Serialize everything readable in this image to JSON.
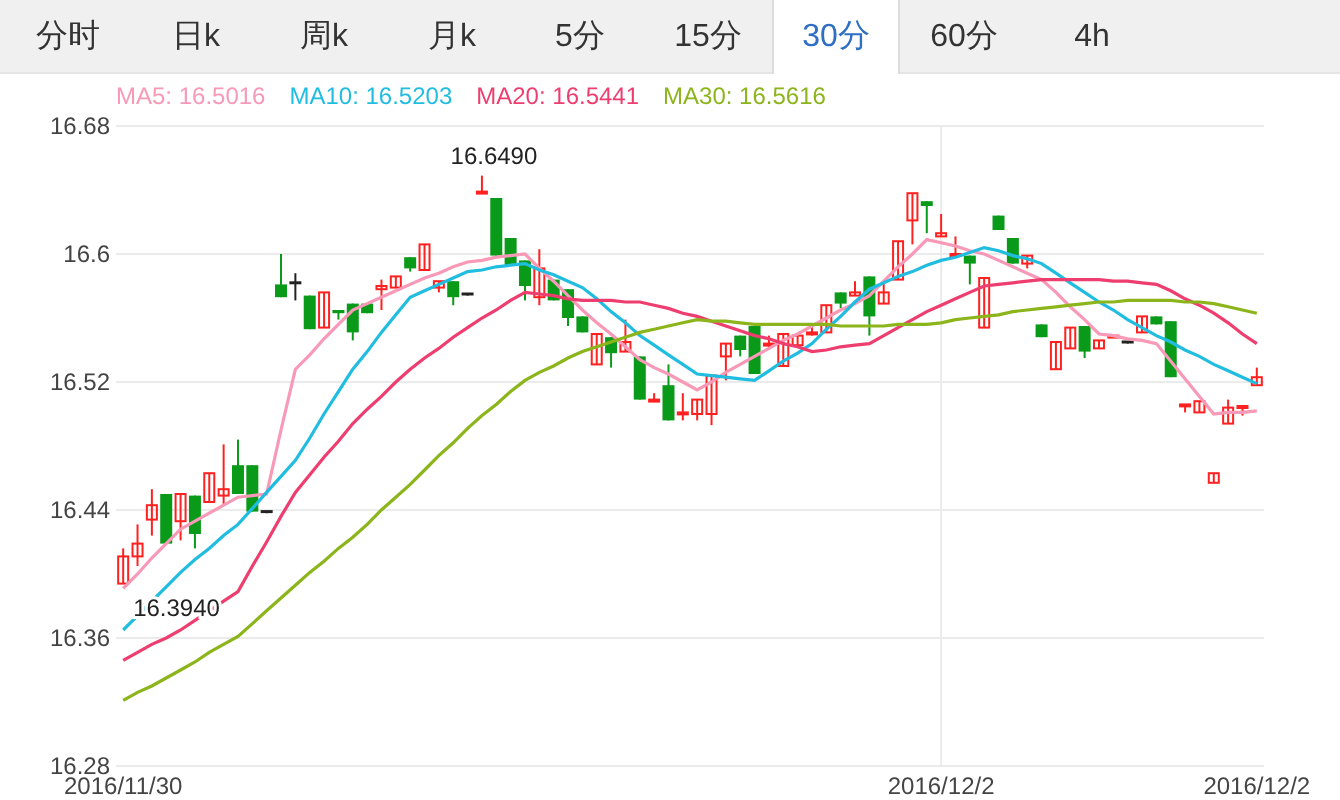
{
  "tabs": [
    {
      "label": "分时",
      "selected": false
    },
    {
      "label": "日k",
      "selected": false
    },
    {
      "label": "周k",
      "selected": false
    },
    {
      "label": "月k",
      "selected": false
    },
    {
      "label": "5分",
      "selected": false
    },
    {
      "label": "15分",
      "selected": false
    },
    {
      "label": "30分",
      "selected": true
    },
    {
      "label": "60分",
      "selected": false
    },
    {
      "label": "4h",
      "selected": false
    }
  ],
  "legend": [
    {
      "value": ": 16.5016"
    },
    {
      "value": ": 16.5203"
    },
    {
      "value": ": 16.5441"
    },
    {
      "value": ": 16.5616"
    }
  ],
  "chart": {
    "chart_data": {
      "type": "candlestick",
      "categories": [
        "2016/11/30",
        null,
        null,
        null,
        null,
        null,
        null,
        null,
        null,
        null,
        null,
        null,
        null,
        null,
        null,
        null,
        null,
        null,
        null,
        null,
        null,
        null,
        null,
        null,
        null,
        null,
        null,
        null,
        null,
        null,
        null,
        null,
        null,
        null,
        null,
        null,
        null,
        null,
        null,
        null,
        null,
        null,
        null,
        null,
        null,
        null,
        null,
        null,
        null,
        null,
        null,
        null,
        null,
        null,
        null,
        null,
        null,
        "2016/12/2",
        null,
        null,
        null,
        null,
        null,
        null,
        null,
        null,
        null,
        null,
        null,
        null,
        null,
        null,
        null,
        null,
        null,
        null,
        null,
        null,
        null,
        "2016/12/2"
      ],
      "ohlc": [
        [
          16.394,
          16.416,
          16.394,
          16.411
        ],
        [
          16.411,
          16.431,
          16.405,
          16.419
        ],
        [
          16.434,
          16.453,
          16.424,
          16.443
        ],
        [
          16.45,
          16.45,
          16.419,
          16.419
        ],
        [
          16.433,
          16.45,
          16.421,
          16.45
        ],
        [
          16.449,
          16.449,
          16.416,
          16.425
        ],
        [
          16.445,
          16.463,
          16.445,
          16.463
        ],
        [
          16.449,
          16.481,
          16.443,
          16.453
        ],
        [
          16.468,
          16.484,
          16.45,
          16.45
        ],
        [
          16.468,
          16.468,
          16.439,
          16.439
        ],
        [
          16.439,
          16.439,
          16.438,
          16.439
        ],
        [
          16.581,
          16.6,
          16.573,
          16.573
        ],
        [
          16.582,
          16.588,
          16.571,
          16.582
        ],
        [
          16.574,
          16.574,
          16.553,
          16.553
        ],
        [
          16.554,
          16.576,
          16.554,
          16.576
        ],
        [
          16.565,
          16.565,
          16.559,
          16.563
        ],
        [
          16.569,
          16.569,
          16.546,
          16.551
        ],
        [
          16.569,
          16.569,
          16.563,
          16.563
        ],
        [
          16.578,
          16.584,
          16.565,
          16.58
        ],
        [
          16.579,
          16.586,
          16.579,
          16.586
        ],
        [
          16.598,
          16.598,
          16.589,
          16.591
        ],
        [
          16.59,
          16.606,
          16.59,
          16.606
        ],
        [
          16.579,
          16.583,
          16.576,
          16.583
        ],
        [
          16.583,
          16.583,
          16.568,
          16.573
        ],
        [
          16.575,
          16.575,
          16.574,
          16.575
        ],
        [
          16.638,
          16.649,
          16.638,
          16.639
        ],
        [
          16.635,
          16.635,
          16.598,
          16.599
        ],
        [
          16.61,
          16.61,
          16.593,
          16.593
        ],
        [
          16.596,
          16.596,
          16.571,
          16.58
        ],
        [
          16.573,
          16.603,
          16.568,
          16.591
        ],
        [
          16.584,
          16.584,
          16.571,
          16.571
        ],
        [
          16.578,
          16.578,
          16.555,
          16.56
        ],
        [
          16.561,
          16.561,
          16.551,
          16.551
        ],
        [
          16.531,
          16.55,
          16.531,
          16.55
        ],
        [
          16.548,
          16.548,
          16.529,
          16.538
        ],
        [
          16.539,
          16.559,
          16.539,
          16.545
        ],
        [
          16.536,
          16.536,
          16.509,
          16.509
        ],
        [
          16.508,
          16.513,
          16.508,
          16.509
        ],
        [
          16.518,
          16.531,
          16.496,
          16.496
        ],
        [
          16.5,
          16.513,
          16.496,
          16.501
        ],
        [
          16.5,
          16.509,
          16.496,
          16.509
        ],
        [
          16.5,
          16.524,
          16.493,
          16.524
        ],
        [
          16.536,
          16.544,
          16.521,
          16.544
        ],
        [
          16.549,
          16.549,
          16.536,
          16.54
        ],
        [
          16.555,
          16.555,
          16.525,
          16.525
        ],
        [
          16.543,
          16.549,
          16.54,
          16.544
        ],
        [
          16.53,
          16.55,
          16.53,
          16.55
        ],
        [
          16.543,
          16.549,
          16.543,
          16.549
        ],
        [
          16.55,
          16.555,
          16.549,
          16.551
        ],
        [
          16.551,
          16.568,
          16.551,
          16.568
        ],
        [
          16.576,
          16.576,
          16.566,
          16.569
        ],
        [
          16.574,
          16.583,
          16.574,
          16.576
        ],
        [
          16.586,
          16.586,
          16.549,
          16.561
        ],
        [
          16.569,
          16.583,
          16.569,
          16.576
        ],
        [
          16.584,
          16.608,
          16.584,
          16.608
        ],
        [
          16.621,
          16.638,
          16.606,
          16.638
        ],
        [
          16.633,
          16.633,
          16.613,
          16.63
        ],
        [
          16.611,
          16.625,
          16.611,
          16.613
        ],
        [
          16.599,
          16.611,
          16.599,
          16.6
        ],
        [
          16.599,
          16.599,
          16.581,
          16.594
        ],
        [
          16.554,
          16.585,
          16.554,
          16.585
        ],
        [
          16.624,
          16.624,
          16.615,
          16.615
        ],
        [
          16.61,
          16.61,
          16.594,
          16.594
        ],
        [
          16.594,
          16.599,
          16.591,
          16.599
        ],
        [
          16.556,
          16.556,
          16.548,
          16.548
        ],
        [
          16.528,
          16.545,
          16.528,
          16.545
        ],
        [
          16.541,
          16.554,
          16.541,
          16.554
        ],
        [
          16.555,
          16.555,
          16.535,
          16.539
        ],
        [
          16.541,
          16.546,
          16.541,
          16.546
        ],
        [
          16.548,
          16.549,
          16.548,
          16.549
        ],
        [
          16.545,
          16.545,
          16.544,
          16.545
        ],
        [
          16.551,
          16.561,
          16.551,
          16.561
        ],
        [
          16.561,
          16.561,
          16.556,
          16.556
        ],
        [
          16.558,
          16.558,
          16.523,
          16.523
        ],
        [
          16.505,
          16.506,
          16.501,
          16.506
        ],
        [
          16.501,
          16.508,
          16.501,
          16.508
        ],
        [
          16.457,
          16.463,
          16.457,
          16.463
        ],
        [
          16.494,
          16.509,
          16.494,
          16.504
        ],
        [
          16.504,
          16.505,
          16.499,
          16.505
        ],
        [
          16.518,
          16.529,
          16.518,
          16.523
        ]
      ],
      "series": [
        {
          "name": "MA5",
          "type": "line",
          "color": "#f799b7",
          "values": [
            16.391,
            16.4,
            16.41,
            16.419,
            16.428,
            16.433,
            16.438,
            16.443,
            16.448,
            16.449,
            16.45,
            16.49,
            16.528,
            16.537,
            16.547,
            16.556,
            16.565,
            16.569,
            16.573,
            16.577,
            16.581,
            16.585,
            16.588,
            16.592,
            16.595,
            16.596,
            16.598,
            16.599,
            16.6,
            16.591,
            16.583,
            16.574,
            16.565,
            16.557,
            16.55,
            16.542,
            16.534,
            16.529,
            16.525,
            16.52,
            16.515,
            16.52,
            16.526,
            16.531,
            16.536,
            16.541,
            16.546,
            16.55,
            16.555,
            16.56,
            16.565,
            16.569,
            16.574,
            16.583,
            16.592,
            16.6,
            16.609,
            16.607,
            16.605,
            16.602,
            16.6,
            16.596,
            16.592,
            16.588,
            16.584,
            16.576,
            16.567,
            16.559,
            16.55,
            16.549,
            16.547,
            16.546,
            16.544,
            16.533,
            16.522,
            16.511,
            16.5,
            16.501,
            16.501,
            16.502
          ]
        },
        {
          "name": "MA10",
          "type": "line",
          "color": "#21bde0",
          "values": [
            16.365,
            16.374,
            16.383,
            16.392,
            16.401,
            16.409,
            16.416,
            16.424,
            16.431,
            16.441,
            16.451,
            16.461,
            16.471,
            16.485,
            16.5,
            16.514,
            16.528,
            16.539,
            16.551,
            16.562,
            16.573,
            16.577,
            16.581,
            16.585,
            16.589,
            16.59,
            16.592,
            16.593,
            16.594,
            16.59,
            16.587,
            16.583,
            16.579,
            16.572,
            16.564,
            16.557,
            16.549,
            16.543,
            16.537,
            16.531,
            16.525,
            16.524,
            16.523,
            16.522,
            16.521,
            16.527,
            16.533,
            16.538,
            16.544,
            16.553,
            16.561,
            16.57,
            16.578,
            16.582,
            16.586,
            16.589,
            16.593,
            16.596,
            16.598,
            16.601,
            16.604,
            16.602,
            16.599,
            16.597,
            16.594,
            16.588,
            16.582,
            16.576,
            16.57,
            16.565,
            16.559,
            16.554,
            16.549,
            16.545,
            16.54,
            16.536,
            16.531,
            16.527,
            16.523,
            16.519
          ]
        },
        {
          "name": "MA20",
          "type": "line",
          "color": "#ee3d6f",
          "values": [
            16.346,
            16.351,
            16.356,
            16.36,
            16.365,
            16.371,
            16.377,
            16.383,
            16.389,
            16.405,
            16.42,
            16.436,
            16.451,
            16.462,
            16.473,
            16.483,
            16.494,
            16.503,
            16.511,
            16.52,
            16.528,
            16.535,
            16.541,
            16.548,
            16.554,
            16.56,
            16.565,
            16.571,
            16.576,
            16.575,
            16.574,
            16.572,
            16.571,
            16.571,
            16.571,
            16.57,
            16.57,
            16.568,
            16.566,
            16.563,
            16.561,
            16.558,
            16.555,
            16.552,
            16.549,
            16.547,
            16.544,
            16.542,
            16.539,
            16.54,
            16.542,
            16.543,
            16.544,
            16.549,
            16.554,
            16.559,
            16.564,
            16.568,
            16.572,
            16.576,
            16.58,
            16.581,
            16.582,
            16.583,
            16.584,
            16.584,
            16.584,
            16.584,
            16.584,
            16.583,
            16.583,
            16.582,
            16.581,
            16.577,
            16.572,
            16.568,
            16.563,
            16.557,
            16.55,
            16.544
          ]
        },
        {
          "name": "MA30",
          "type": "line",
          "color": "#8cb51c",
          "values": [
            16.321,
            16.326,
            16.33,
            16.335,
            16.34,
            16.345,
            16.351,
            16.356,
            16.361,
            16.369,
            16.377,
            16.385,
            16.393,
            16.401,
            16.408,
            16.416,
            16.423,
            16.431,
            16.44,
            16.448,
            16.456,
            16.465,
            16.474,
            16.482,
            16.491,
            16.499,
            16.506,
            16.514,
            16.521,
            16.526,
            16.53,
            16.535,
            16.539,
            16.542,
            16.545,
            16.548,
            16.551,
            16.553,
            16.555,
            16.557,
            16.559,
            16.558,
            16.558,
            16.557,
            16.556,
            16.556,
            16.556,
            16.556,
            16.556,
            16.556,
            16.555,
            16.555,
            16.555,
            16.555,
            16.556,
            16.556,
            16.556,
            16.557,
            16.559,
            16.56,
            16.561,
            16.562,
            16.564,
            16.565,
            16.566,
            16.567,
            16.568,
            16.569,
            16.57,
            16.57,
            16.571,
            16.571,
            16.571,
            16.571,
            16.57,
            16.57,
            16.569,
            16.567,
            16.565,
            16.563
          ]
        }
      ],
      "ylim": [
        16.28,
        16.68
      ],
      "yticks": [
        16.28,
        16.36,
        16.44,
        16.52,
        16.6,
        16.68
      ],
      "grid": true,
      "annotations": [
        {
          "text": "16.6490"
        },
        {
          "text": "16.3940"
        }
      ]
    }
  }
}
